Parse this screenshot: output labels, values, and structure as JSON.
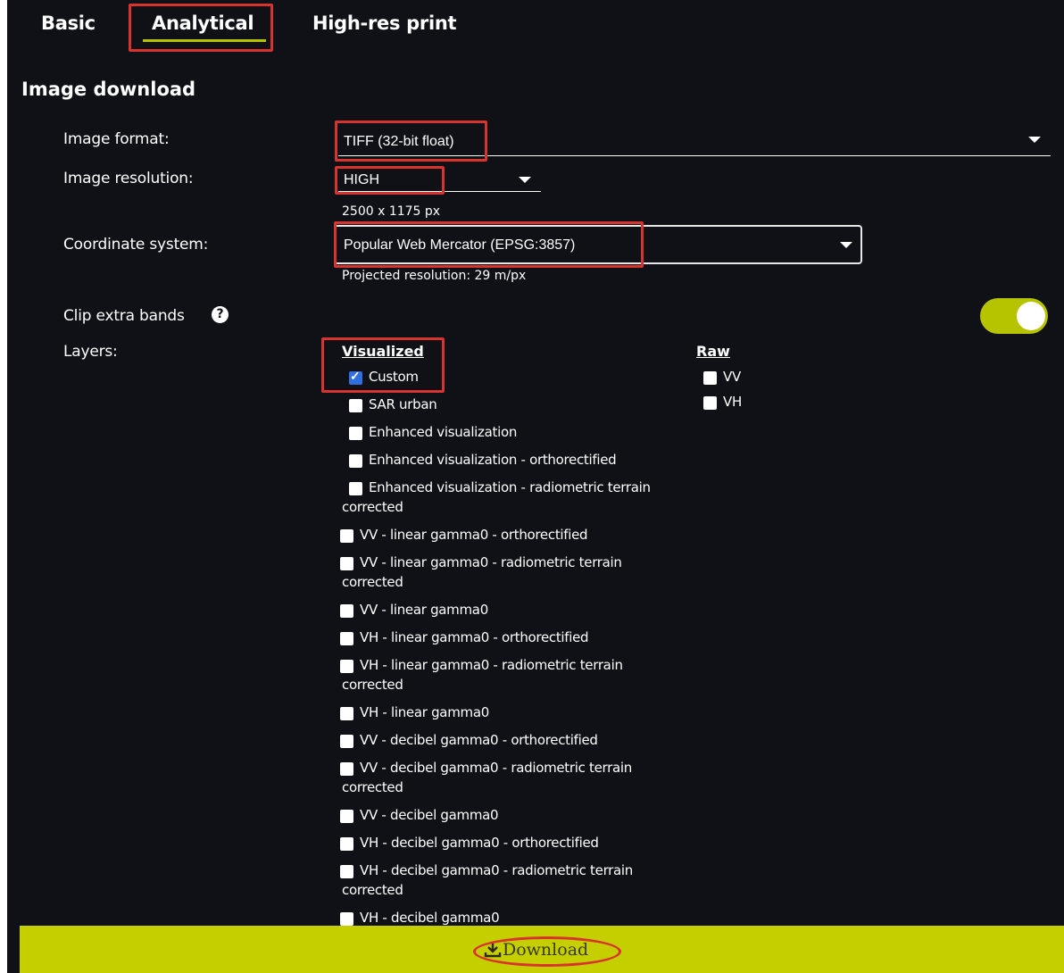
{
  "tabs": [
    {
      "label": "Basic"
    },
    {
      "label": "Analytical",
      "active": true
    },
    {
      "label": "High-res print"
    }
  ],
  "section_title": "Image download",
  "form": {
    "image_format": {
      "label": "Image format:",
      "value": "TIFF (32-bit float)"
    },
    "image_resolution": {
      "label": "Image resolution:",
      "value": "HIGH",
      "hint": "2500 x 1175 px"
    },
    "coordinate_system": {
      "label": "Coordinate system:",
      "value": "Popular Web Mercator (EPSG:3857)",
      "hint": "Projected resolution: 29 m/px"
    },
    "clip_extra_bands": {
      "label": "Clip extra bands",
      "help_glyph": "?",
      "enabled": true
    },
    "layers_label": "Layers:"
  },
  "layers": {
    "visualized_header": "Visualized",
    "raw_header": "Raw",
    "visualized_items": [
      {
        "label": "Custom",
        "checked": true
      },
      {
        "label": "SAR urban",
        "checked": false
      },
      {
        "label": "Enhanced visualization",
        "checked": false
      },
      {
        "label": "Enhanced visualization - orthorectified",
        "checked": false
      },
      {
        "label": "Enhanced visualization - radiometric terrain",
        "cont": "corrected",
        "checked": false
      },
      {
        "label": "VV - linear gamma0 - orthorectified",
        "checked": false
      },
      {
        "label": "VV - linear gamma0 - radiometric terrain",
        "cont": "corrected",
        "checked": false
      },
      {
        "label": "VV - linear gamma0",
        "checked": false
      },
      {
        "label": "VH - linear gamma0 - orthorectified",
        "checked": false
      },
      {
        "label": "VH - linear gamma0 - radiometric terrain",
        "cont": "corrected",
        "checked": false
      },
      {
        "label": "VH - linear gamma0",
        "checked": false
      },
      {
        "label": "VV - decibel gamma0 - orthorectified",
        "checked": false
      },
      {
        "label": "VV - decibel gamma0 - radiometric terrain",
        "cont": "corrected",
        "checked": false
      },
      {
        "label": "VV - decibel gamma0",
        "checked": false
      },
      {
        "label": "VH - decibel gamma0 - orthorectified",
        "checked": false
      },
      {
        "label": "VH - decibel gamma0 - radiometric terrain",
        "cont": "corrected",
        "checked": false
      },
      {
        "label": "VH - decibel gamma0",
        "checked": false
      }
    ],
    "raw_items": [
      {
        "label": "VV",
        "checked": false
      },
      {
        "label": "VH",
        "checked": false
      }
    ]
  },
  "download": {
    "label": "Download",
    "icon": "download-icon"
  },
  "colors": {
    "accent": "#c5cf00",
    "background": "#0f1116",
    "annotation": "#d8332f",
    "checkbox_checked": "#2f6fe0"
  }
}
